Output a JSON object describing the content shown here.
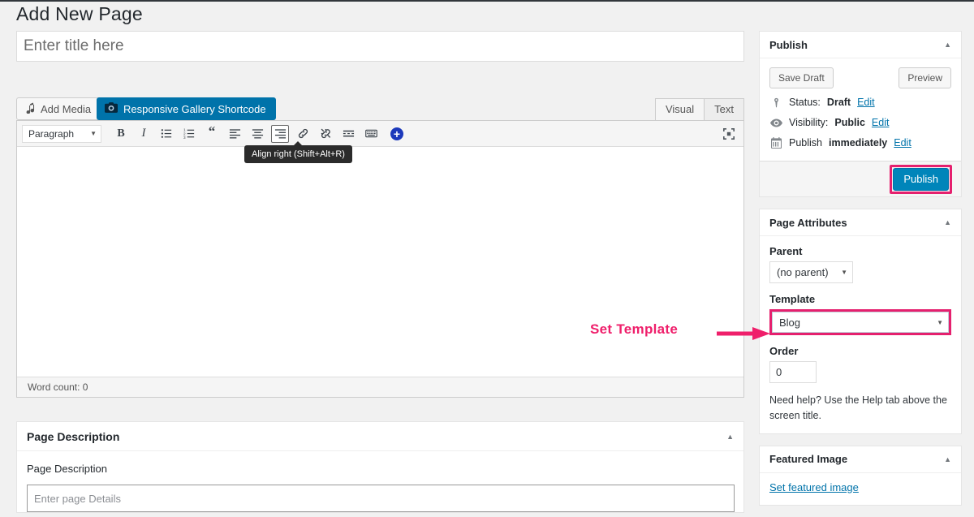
{
  "page": {
    "title": "Add New Page"
  },
  "editor": {
    "title_placeholder": "Enter title here",
    "add_media_label": "Add Media",
    "gallery_shortcode_label": "Responsive Gallery Shortcode",
    "tabs": [
      {
        "label": "Visual",
        "active": true
      },
      {
        "label": "Text",
        "active": false
      }
    ],
    "format_select": "Paragraph",
    "toolbar_buttons": [
      {
        "name": "bold",
        "label": "B"
      },
      {
        "name": "italic",
        "label": "I"
      },
      {
        "name": "bulleted-list",
        "label": ""
      },
      {
        "name": "numbered-list",
        "label": ""
      },
      {
        "name": "blockquote",
        "label": "“"
      },
      {
        "name": "align-left",
        "label": ""
      },
      {
        "name": "align-center",
        "label": ""
      },
      {
        "name": "align-right",
        "label": "",
        "active": true
      },
      {
        "name": "insert-link",
        "label": ""
      },
      {
        "name": "remove-link",
        "label": ""
      },
      {
        "name": "read-more",
        "label": ""
      },
      {
        "name": "toolbar-toggle",
        "label": ""
      },
      {
        "name": "add-block",
        "label": "+"
      }
    ],
    "tooltip": "Align right (Shift+Alt+R)",
    "word_count": "Word count: 0"
  },
  "page_description": {
    "box_title": "Page Description",
    "field_label": "Page Description",
    "placeholder": "Enter page Details"
  },
  "publish": {
    "box_title": "Publish",
    "save_draft": "Save Draft",
    "preview": "Preview",
    "status_label": "Status:",
    "status_value": "Draft",
    "status_edit": "Edit",
    "visibility_label": "Visibility:",
    "visibility_value": "Public",
    "visibility_edit": "Edit",
    "schedule_label": "Publish",
    "schedule_value": "immediately",
    "schedule_edit": "Edit",
    "publish_button": "Publish"
  },
  "page_attributes": {
    "box_title": "Page Attributes",
    "parent_label": "Parent",
    "parent_value": "(no parent)",
    "template_label": "Template",
    "template_value": "Blog",
    "order_label": "Order",
    "order_value": "0",
    "help_text": "Need help? Use the Help tab above the screen title."
  },
  "featured_image": {
    "box_title": "Featured Image",
    "set_link": "Set featured image"
  },
  "annotation": {
    "text": "Set Template"
  },
  "colors": {
    "accent_pink": "#e5206e",
    "annotation_pink": "#ef1f6b",
    "wp_blue": "#0085ba",
    "link_blue": "#0073aa",
    "gallery_blue": "#0073aa"
  }
}
